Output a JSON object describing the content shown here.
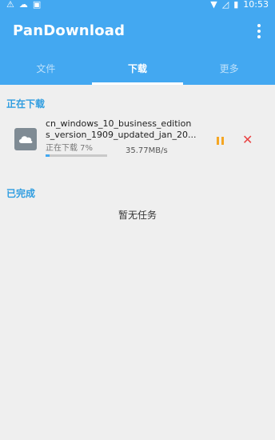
{
  "status_bar": {
    "time": "10:53"
  },
  "app": {
    "title": "PanDownload"
  },
  "tabs": [
    {
      "label": "文件",
      "active": false
    },
    {
      "label": "下载",
      "active": true
    },
    {
      "label": "更多",
      "active": false
    }
  ],
  "sections": {
    "downloading": "正在下载",
    "completed": "已完成"
  },
  "download": {
    "filename": "cn_windows_10_business_edition\ns_version_1909_updated_jan_20...",
    "status": "正在下载 7%",
    "progress": 0.07,
    "speed": "35.77MB/s"
  },
  "completed_empty": "暂无任务",
  "colors": {
    "accent": "#43a8f1",
    "pause": "#f5a623",
    "close": "#e94444"
  }
}
